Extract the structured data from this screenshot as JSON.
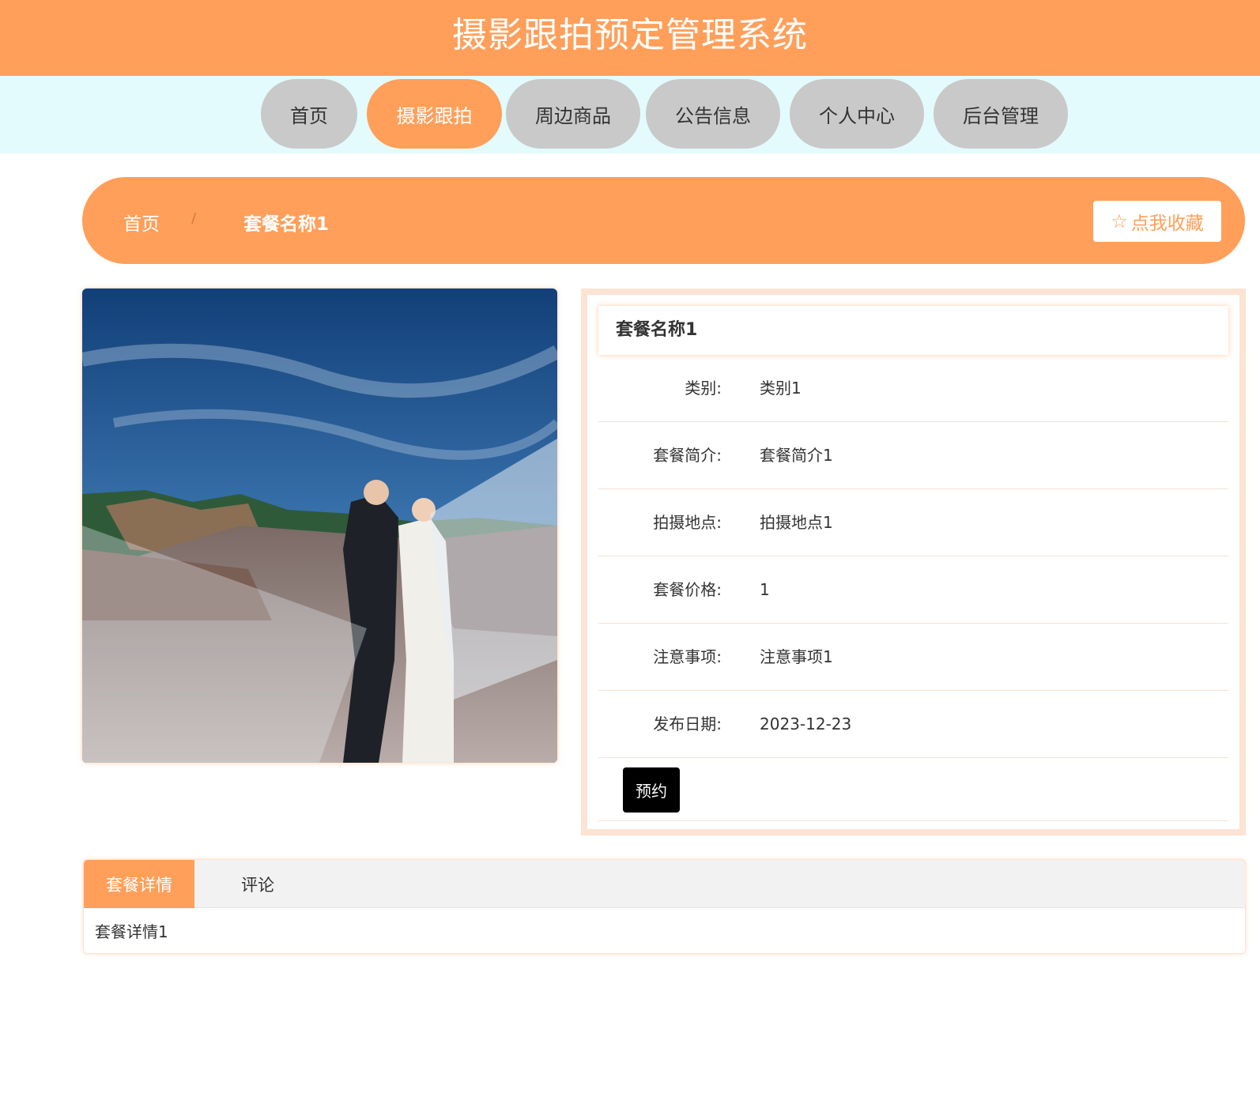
{
  "header": {
    "title": "摄影跟拍预定管理系统"
  },
  "nav": {
    "items": [
      {
        "label": "首页"
      },
      {
        "label": "摄影跟拍",
        "active": true
      },
      {
        "label": "周边商品"
      },
      {
        "label": "公告信息"
      },
      {
        "label": "个人中心"
      },
      {
        "label": "后台管理"
      }
    ]
  },
  "breadcrumb": {
    "home": "首页",
    "separator": "/",
    "current": "套餐名称1"
  },
  "favorite": {
    "icon": "star-outline-icon",
    "label": "点我收藏"
  },
  "package": {
    "name": "套餐名称1",
    "fields": [
      {
        "label": "类别:",
        "value": "类别1"
      },
      {
        "label": "套餐简介:",
        "value": "套餐简介1"
      },
      {
        "label": "拍摄地点:",
        "value": "拍摄地点1"
      },
      {
        "label": "套餐价格:",
        "value": "1"
      },
      {
        "label": "注意事项:",
        "value": "注意事项1"
      },
      {
        "label": "发布日期:",
        "value": "2023-12-23"
      }
    ],
    "book_label": "预约"
  },
  "tabs": {
    "items": [
      {
        "label": "套餐详情",
        "active": true
      },
      {
        "label": "评论"
      }
    ],
    "content": "套餐详情1"
  },
  "colors": {
    "accent": "#ff9f5a",
    "nav_bg": "#e3fbfc",
    "nav_inactive": "#c9c9c9",
    "panel_border": "#fde3d3"
  }
}
